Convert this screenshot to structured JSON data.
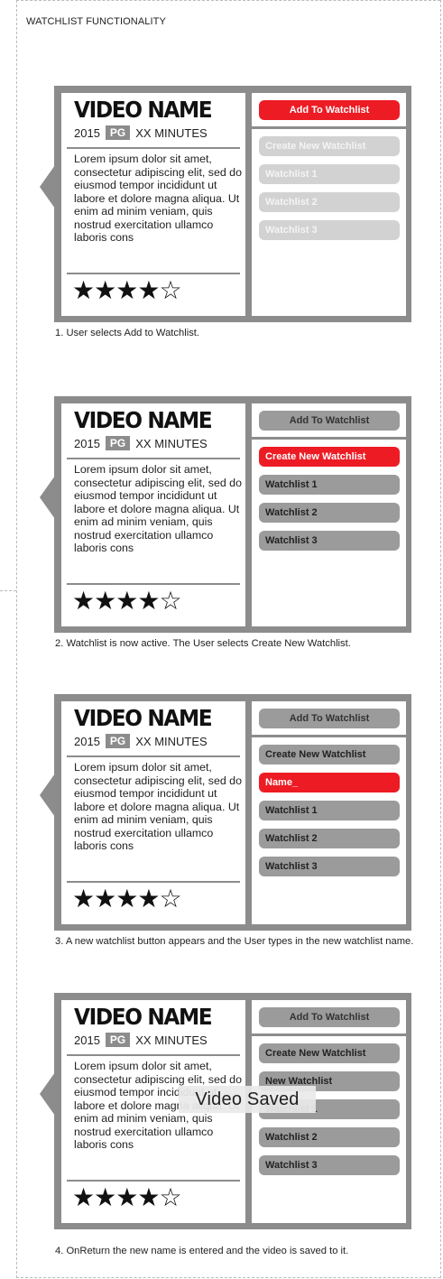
{
  "page_title": "WATCHLIST FUNCTIONALITY",
  "video": {
    "name": "VIDEO NAME",
    "year": "2015",
    "rating": "PG",
    "duration": "XX MINUTES",
    "description": "Lorem ipsum dolor sit amet, consectetur adipiscing elit, sed do eiusmod tempor incididunt ut labore et dolore magna aliqua. Ut enim ad minim veniam, quis nostrud exercitation ullamco laboris cons",
    "stars": [
      "★",
      "★",
      "★",
      "★",
      "☆"
    ],
    "star_score": 4,
    "star_max": 5
  },
  "colors": {
    "accent": "#ed1c24",
    "frame": "#8c8c8c",
    "disabled": "#d2d2d2",
    "button": "#9b9b9b"
  },
  "steps": [
    {
      "add_label": "Add To Watchlist",
      "items": [
        "Create New Watchlist",
        "Watchlist 1",
        "Watchlist 2",
        "Watchlist 3"
      ],
      "caption": "1. User selects Add to Watchlist."
    },
    {
      "add_label": "Add To Watchlist",
      "items": [
        "Create New Watchlist",
        "Watchlist 1",
        "Watchlist 2",
        "Watchlist 3"
      ],
      "caption": "2. Watchlist is now active. The User selects Create New Watchlist."
    },
    {
      "add_label": "Add To Watchlist",
      "items": [
        "Create New Watchlist",
        "Name_",
        "Watchlist 1",
        "Watchlist 2",
        "Watchlist 3"
      ],
      "caption": "3. A new watchlist button appears and the User types in the new watchlist name."
    },
    {
      "add_label": "Add To Watchlist",
      "items": [
        "Create New Watchlist",
        "New Watchlist",
        "Watchlist 1",
        "Watchlist 2",
        "Watchlist 3"
      ],
      "toast": "Video Saved",
      "caption": "4. OnReturn the new name is entered and the video is saved to it."
    }
  ]
}
